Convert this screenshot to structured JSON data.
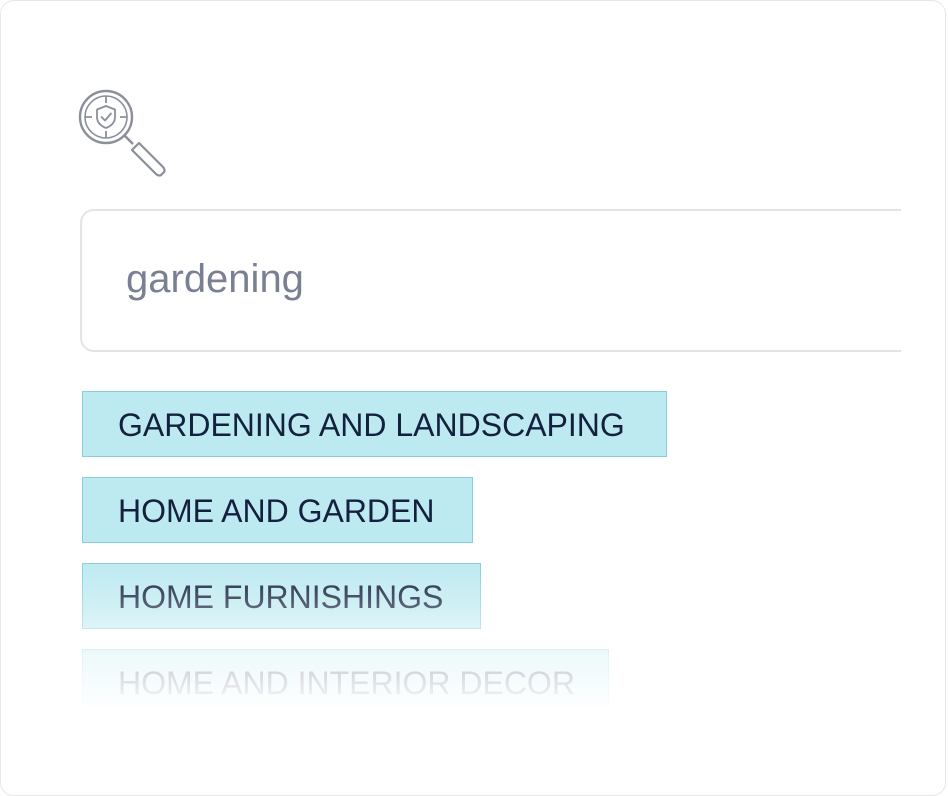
{
  "search": {
    "icon": "shield-magnifier-icon",
    "value": "gardening",
    "placeholder": ""
  },
  "suggestions": [
    {
      "label": "GARDENING AND LANDSCAPING"
    },
    {
      "label": "HOME AND GARDEN"
    },
    {
      "label": "HOME FURNISHINGS"
    },
    {
      "label": "HOME AND INTERIOR DECOR"
    }
  ],
  "colors": {
    "chip_background": "#bdeaf0",
    "chip_border": "#86cfe0",
    "chip_text": "#13203e",
    "input_text": "#7a8093",
    "icon_stroke": "#8b8f99"
  }
}
